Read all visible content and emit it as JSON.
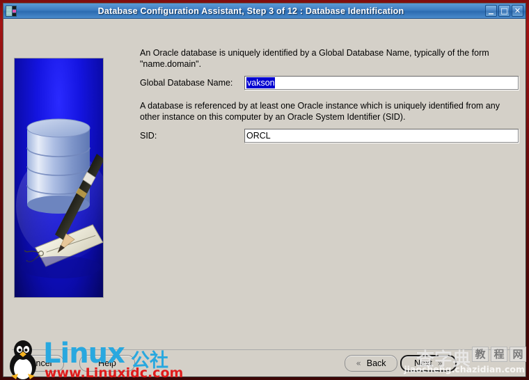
{
  "window": {
    "title": "Database Configuration Assistant, Step 3 of 12 : Database Identification",
    "icon_name": "database-assistant-icon",
    "controls": {
      "minimize": "_",
      "maximize": "□",
      "close": "✕"
    }
  },
  "main": {
    "paragraph1": "An Oracle database is uniquely identified by a Global Database Name, typically of the form \"name.domain\".",
    "paragraph2": "A database is referenced by at least one Oracle instance which is uniquely identified from any other instance on this computer by an Oracle System Identifier (SID).",
    "fields": [
      {
        "label": "Global Database Name:",
        "value": "vakson",
        "selected": true
      },
      {
        "label": "SID:",
        "value": "ORCL",
        "selected": false
      }
    ],
    "artwork_name": "oracle-database-cylinder-pen-tag-illustration"
  },
  "buttons": {
    "cancel": "Cancel",
    "cancel_mnemonic": "C",
    "help": "Help",
    "help_mnemonic": "H",
    "back": "Back",
    "back_mnemonic": "B",
    "back_arrow": "«",
    "next": "Next",
    "next_mnemonic": "N",
    "next_arrow": "»"
  },
  "watermarks": {
    "left_brand": "Linux",
    "left_brand_cn": "公社",
    "left_url": "www.Linuxidc.com",
    "right_cn_1": "查",
    "right_cn_2": "字",
    "right_cn_3": "典",
    "right_box_1": "教",
    "right_box_2": "程",
    "right_box_3": "网",
    "right_url": "jiaocheng.chazidian.com"
  },
  "colors": {
    "titlebar_blue": "#3d7cc0",
    "window_face": "#d4d0c8",
    "selection_blue": "#0000d0",
    "art_blue": "#1414e0",
    "watermark_cyan": "#29a8df",
    "watermark_red": "#e01b1b",
    "desktop_red": "#7e0d0d"
  }
}
